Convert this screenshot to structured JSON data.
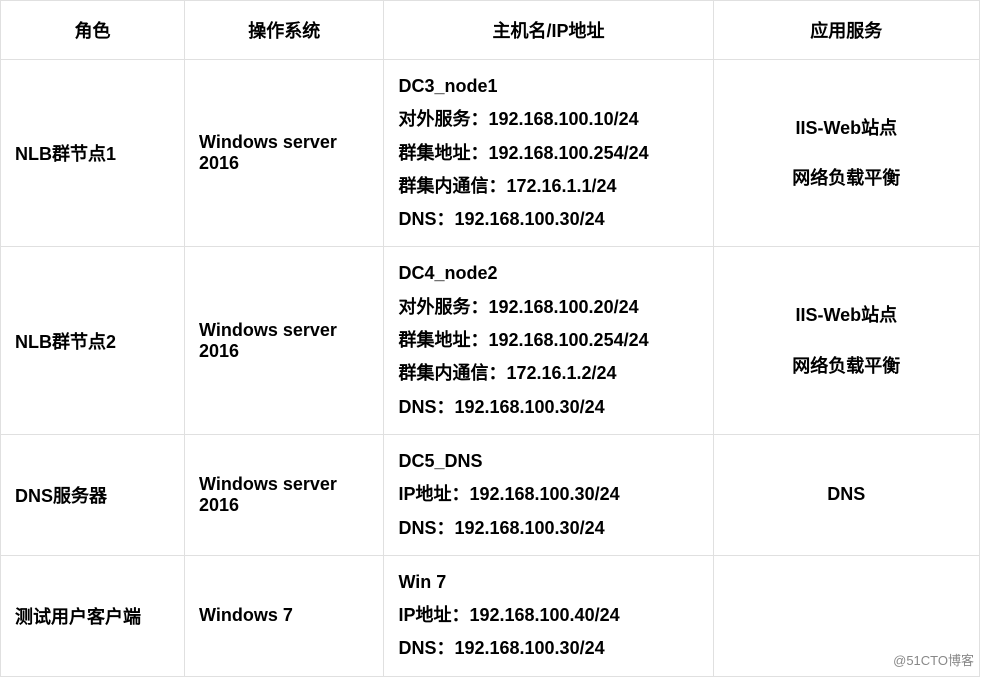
{
  "headers": {
    "role": "角色",
    "os": "操作系统",
    "host": "主机名/IP地址",
    "svc": "应用服务"
  },
  "rows": [
    {
      "role": "NLB群节点1",
      "os": "Windows server 2016",
      "host_lines": [
        "DC3_node1",
        "对外服务：192.168.100.10/24",
        "群集地址：192.168.100.254/24",
        "群集内通信：172.16.1.1/24",
        "DNS：192.168.100.30/24"
      ],
      "svc_lines": [
        "IIS-Web站点",
        "网络负载平衡"
      ]
    },
    {
      "role": "NLB群节点2",
      "os": "Windows server 2016",
      "host_lines": [
        "DC4_node2",
        "对外服务：192.168.100.20/24",
        "群集地址：192.168.100.254/24",
        "群集内通信：172.16.1.2/24",
        "DNS：192.168.100.30/24"
      ],
      "svc_lines": [
        "IIS-Web站点",
        "网络负载平衡"
      ]
    },
    {
      "role": "DNS服务器",
      "os": "Windows server 2016",
      "host_lines": [
        "DC5_DNS",
        "IP地址：192.168.100.30/24",
        "DNS：192.168.100.30/24"
      ],
      "svc_lines": [
        "DNS"
      ]
    },
    {
      "role": "测试用户客户端",
      "os": "Windows 7",
      "host_lines": [
        "Win 7",
        "IP地址：192.168.100.40/24",
        "DNS：192.168.100.30/24"
      ],
      "svc_lines": []
    }
  ],
  "watermark": "@51CTO博客"
}
